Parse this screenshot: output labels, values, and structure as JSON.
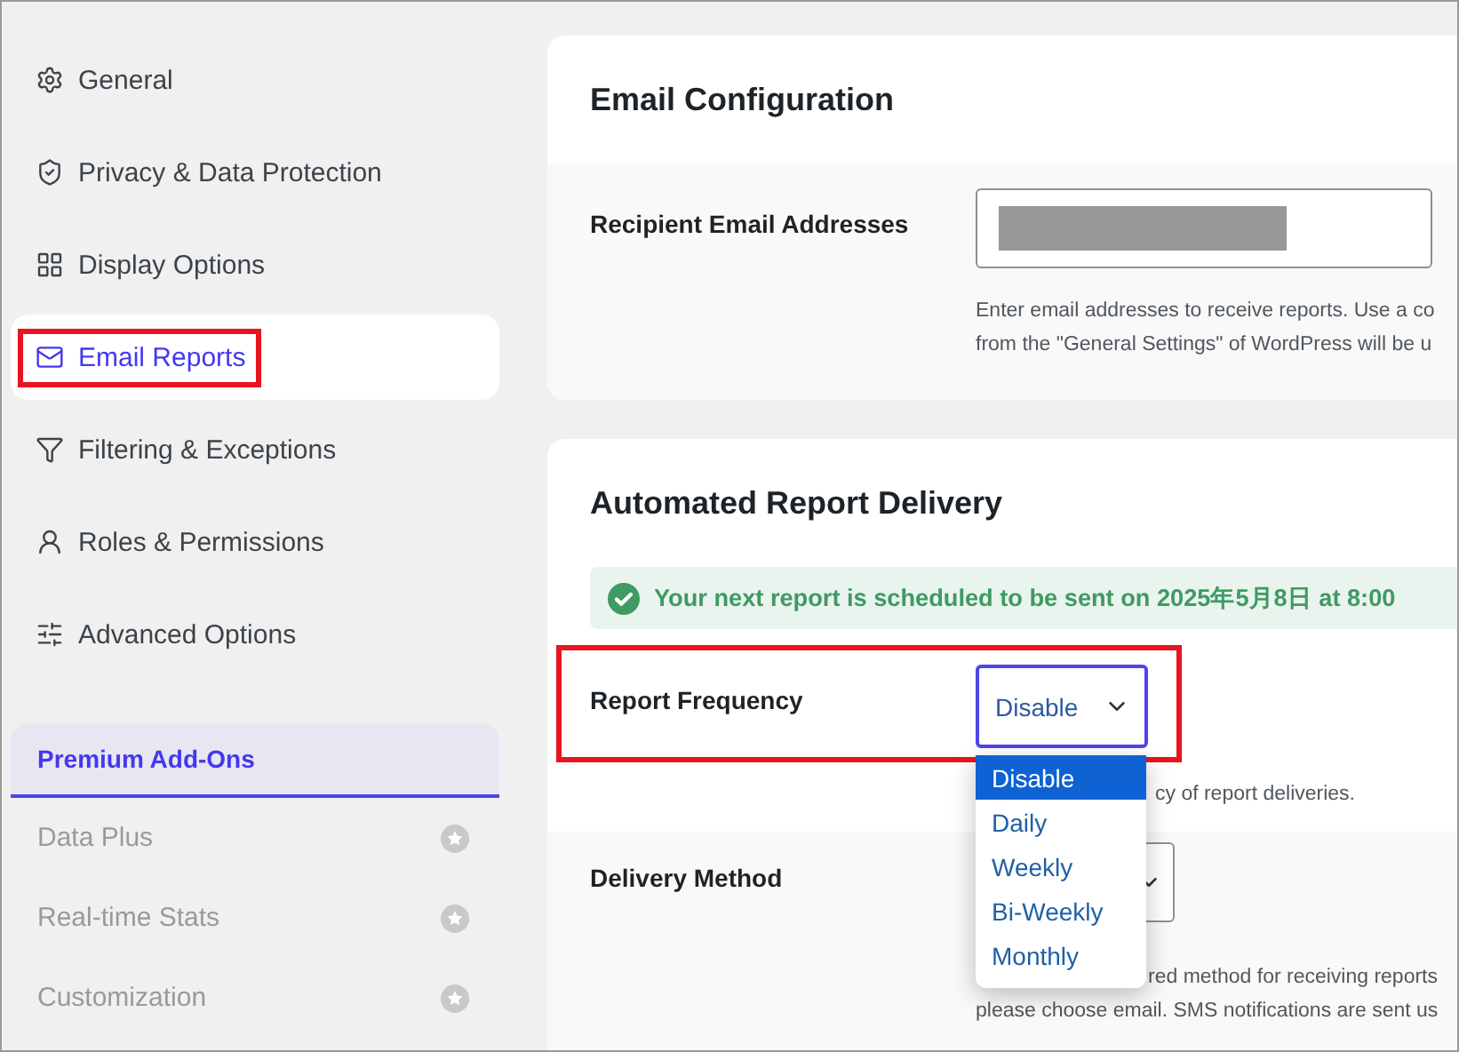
{
  "sidebar": {
    "items": [
      {
        "label": "General",
        "selected": false,
        "highlighted": false
      },
      {
        "label": "Privacy & Data Protection",
        "selected": false,
        "highlighted": false
      },
      {
        "label": "Display Options",
        "selected": false,
        "highlighted": false
      },
      {
        "label": "Email Reports",
        "selected": true,
        "highlighted": true
      },
      {
        "label": "Filtering & Exceptions",
        "selected": false,
        "highlighted": false
      },
      {
        "label": "Roles & Permissions",
        "selected": false,
        "highlighted": false
      },
      {
        "label": "Advanced Options",
        "selected": false,
        "highlighted": false
      }
    ],
    "premium": {
      "title": "Premium Add-Ons",
      "items": [
        {
          "label": "Data Plus",
          "disabled": true
        },
        {
          "label": "Real-time Stats",
          "disabled": true
        },
        {
          "label": "Customization",
          "disabled": true
        }
      ]
    }
  },
  "email_configuration": {
    "title": "Email Configuration",
    "recipient": {
      "label": "Recipient Email Addresses",
      "redacted": true,
      "hint_lines": [
        "Enter email addresses to receive reports. Use a co",
        "from the \"General Settings\" of WordPress will be u"
      ]
    }
  },
  "automated_delivery": {
    "title": "Automated Report Delivery",
    "notice": "Your next report is scheduled to be sent on 2025年5月8日 at 8:00",
    "frequency": {
      "label": "Report Frequency",
      "value": "Disable",
      "highlighted": true,
      "hint": "cy of report deliveries.",
      "open": true,
      "options": [
        {
          "label": "Disable",
          "selected": true
        },
        {
          "label": "Daily",
          "selected": false
        },
        {
          "label": "Weekly",
          "selected": false
        },
        {
          "label": "Bi-Weekly",
          "selected": false
        },
        {
          "label": "Monthly",
          "selected": false
        }
      ]
    },
    "delivery_method": {
      "label": "Delivery Method",
      "hint_lines": [
        "red method for receiving reports",
        "please choose email. SMS notifications are sent us"
      ]
    }
  }
}
